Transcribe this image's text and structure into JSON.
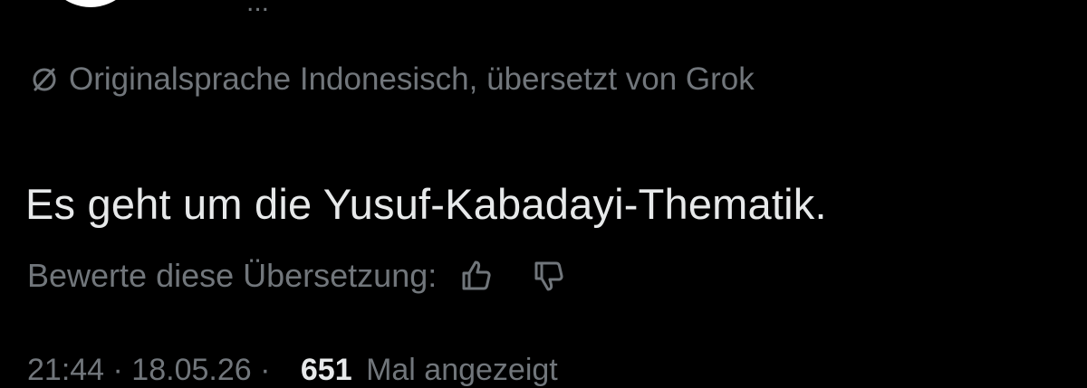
{
  "header": {
    "name_fragment": "..."
  },
  "translation": {
    "icon": "no-translate-icon",
    "note": "Originalsprache Indonesisch, übersetzt von Grok"
  },
  "post": {
    "text": "Es geht um die Yusuf-Kabadayi-Thematik."
  },
  "rating": {
    "label": "Bewerte diese Übersetzung:",
    "thumbs_up_icon": "thumbs-up-icon",
    "thumbs_down_icon": "thumbs-down-icon"
  },
  "meta": {
    "timestamp": "21:44 · 18.05.26 ·",
    "views": "651",
    "views_label": "Mal angezeigt"
  },
  "colors": {
    "background": "#000000",
    "primary_text": "#e7e9ea",
    "secondary_text": "#71767b"
  }
}
